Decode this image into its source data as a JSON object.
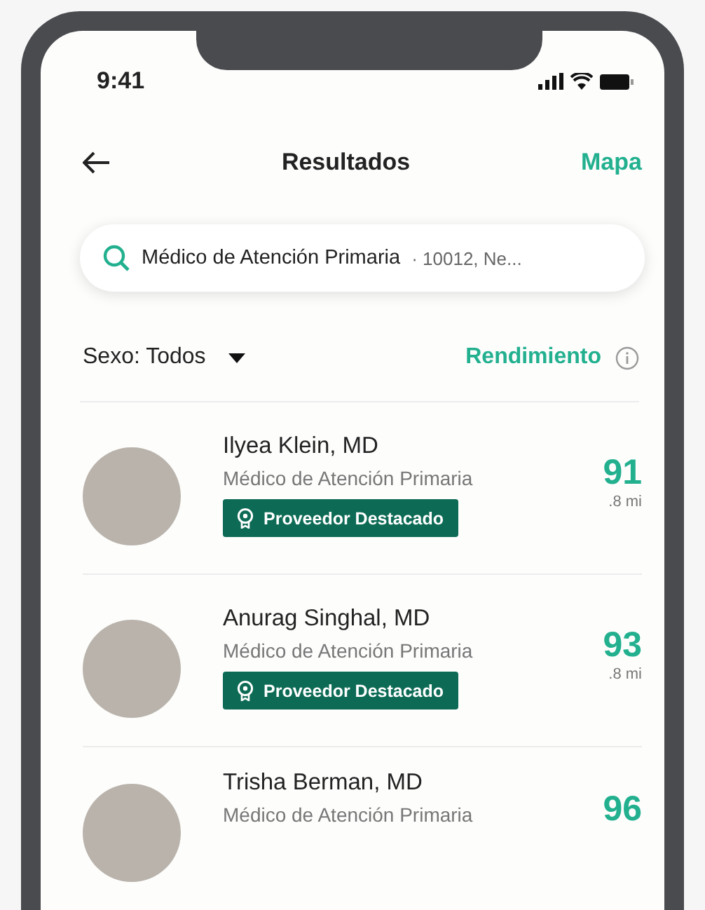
{
  "status_bar": {
    "time": "9:41"
  },
  "header": {
    "title": "Resultados",
    "action": "Mapa"
  },
  "search": {
    "value": "Médico de Atención Primaria",
    "location": "· 10012, Ne..."
  },
  "filters": {
    "sex_filter": "Sexo: Todos",
    "sort": "Rendimiento"
  },
  "doctors": [
    {
      "name": "Ilyea Klein, MD",
      "specialty": "Médico de Atención Primaria",
      "badge": "Proveedor Destacado",
      "score": "91",
      "distance": ".8 mi"
    },
    {
      "name": "Anurag Singhal, MD",
      "specialty": "Médico de Atención Primaria",
      "badge": "Proveedor Destacado",
      "score": "93",
      "distance": ".8 mi"
    },
    {
      "name": "Trisha Berman, MD",
      "specialty": "Médico de Atención Primaria",
      "score": "96"
    }
  ]
}
